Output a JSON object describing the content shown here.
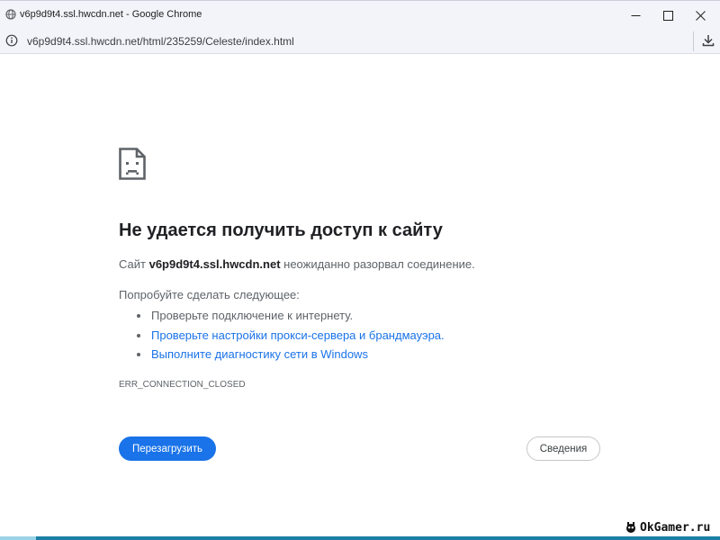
{
  "window": {
    "title": "v6p9d9t4.ssl.hwcdn.net - Google Chrome",
    "favicon": "globe-icon",
    "controls": [
      "minimize-icon",
      "maximize-icon",
      "close-icon"
    ]
  },
  "addressbar": {
    "site_info_icon": "info-icon",
    "url": "v6p9d9t4.ssl.hwcdn.net/html/235259/Celeste/index.html",
    "download_icon": "download-icon"
  },
  "error_page": {
    "icon": "sad-page-icon",
    "heading": "Не удается получить доступ к сайту",
    "summary_prefix": "Сайт ",
    "summary_host": "v6p9d9t4.ssl.hwcdn.net",
    "summary_suffix": " неожиданно разорвал соединение.",
    "suggestions_label": "Попробуйте сделать следующее:",
    "suggestions": [
      {
        "text": "Проверьте подключение к интернету.",
        "link": false
      },
      {
        "text": "Проверьте настройки прокси-сервера и брандмауэра.",
        "link": true
      },
      {
        "text": "Выполните диагностику сети в Windows",
        "link": true
      }
    ],
    "error_code": "ERR_CONNECTION_CLOSED",
    "reload_label": "Перезагрузить",
    "details_label": "Сведения"
  },
  "watermark": {
    "text": "OkGamer.ru",
    "icon": "okgamer-logo-icon"
  },
  "colors": {
    "accent": "#1a73e8",
    "chrome_bg": "#f2f4f9",
    "text_primary": "#202124",
    "text_secondary": "#5f6368"
  }
}
